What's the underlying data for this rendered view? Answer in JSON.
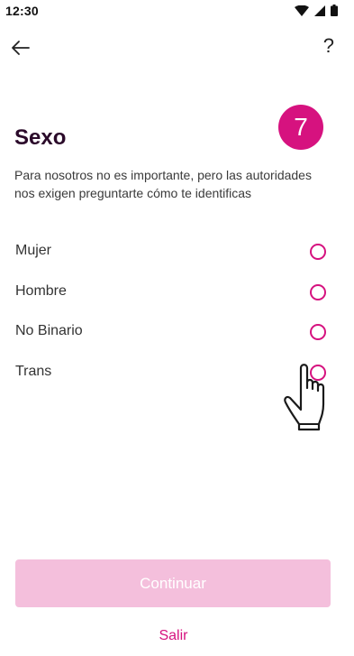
{
  "status_bar": {
    "time": "12:30",
    "icons": [
      "wifi-icon",
      "cell-signal-icon",
      "battery-icon"
    ]
  },
  "header": {
    "back_icon": "arrow-left-icon",
    "help_label": "?"
  },
  "step": {
    "number": "7"
  },
  "main": {
    "title": "Sexo",
    "description": "Para nosotros no es importante, pero las autoridades nos exigen preguntarte cómo te identificas",
    "options": [
      {
        "label": "Mujer",
        "selected": false
      },
      {
        "label": "Hombre",
        "selected": false
      },
      {
        "label": "No Binario",
        "selected": false
      },
      {
        "label": "Trans",
        "selected": false
      }
    ]
  },
  "footer": {
    "continue_label": "Continuar",
    "exit_label": "Salir"
  },
  "colors": {
    "accent": "#d6127f",
    "button_disabled": "#f4bfdc",
    "title": "#2b0a2a"
  }
}
